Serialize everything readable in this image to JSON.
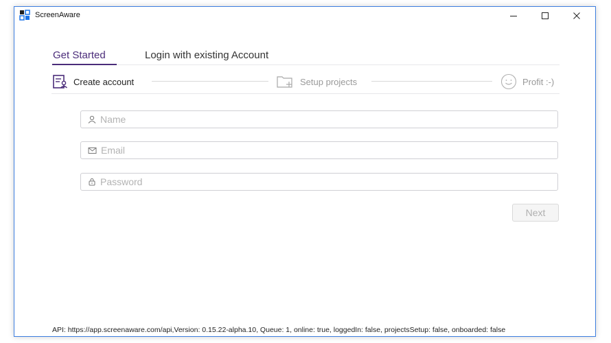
{
  "window": {
    "title": "ScreenAware",
    "controls": {
      "minimize": "–",
      "maximize": "☐",
      "close": "✕"
    }
  },
  "tabs": [
    {
      "label": "Get Started",
      "active": true
    },
    {
      "label": "Login with existing Account",
      "active": false
    }
  ],
  "steps": [
    {
      "label": "Create account",
      "icon": "create-account-icon",
      "active": true
    },
    {
      "label": "Setup projects",
      "icon": "add-folder-icon",
      "active": false
    },
    {
      "label": "Profit :-)",
      "icon": "smiley-icon",
      "active": false
    }
  ],
  "form": {
    "name": {
      "placeholder": "Name",
      "value": "",
      "icon": "user-icon"
    },
    "email": {
      "placeholder": "Email",
      "value": "",
      "icon": "mail-icon"
    },
    "password": {
      "placeholder": "Password",
      "value": "",
      "icon": "lock-icon"
    },
    "next_label": "Next",
    "next_enabled": false
  },
  "status_bar": "API: https://app.screenaware.com/api,Version: 0.15.22-alpha.10, Queue: 1, online: true, loggedIn: false, projectsSetup: false, onboarded: false",
  "colors": {
    "accent": "#4b2c7a",
    "window_border": "#3c7ee0",
    "app_icon": "#1a73e8"
  }
}
